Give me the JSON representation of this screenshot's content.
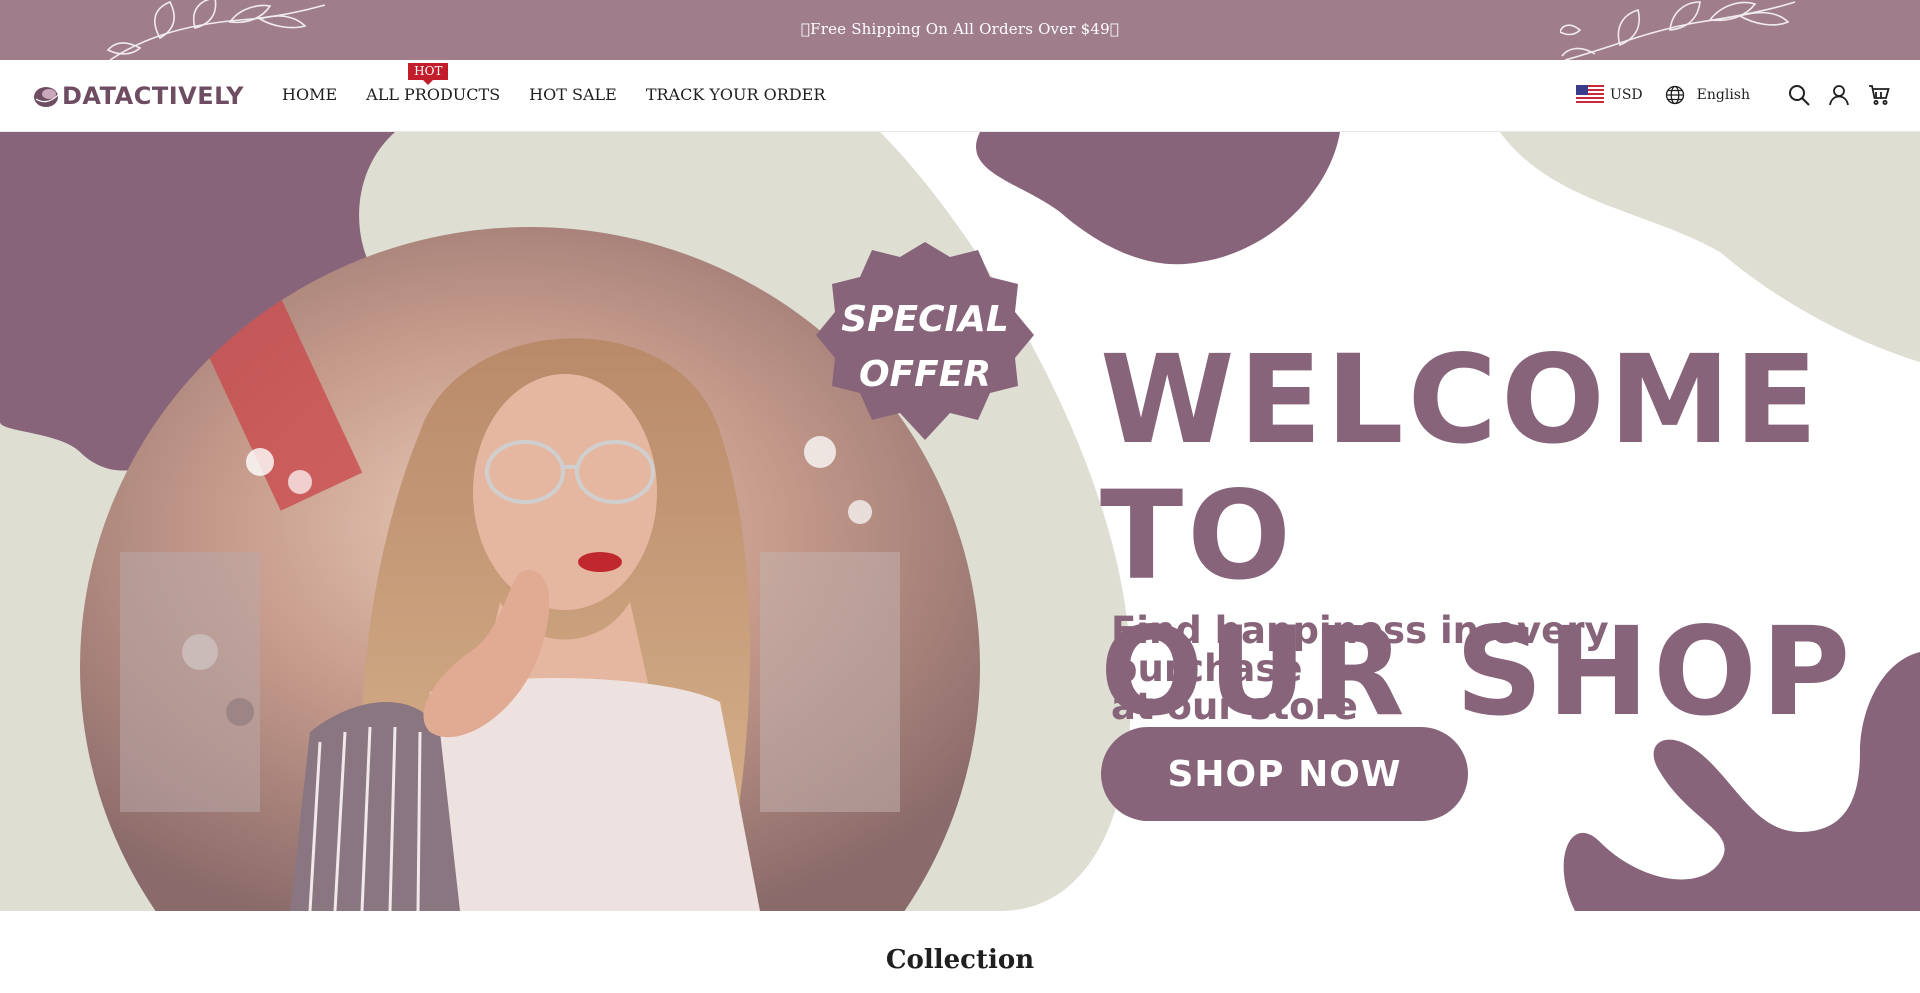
{
  "announcement": {
    "text": "\u0000Free Shipping On All Orders Over $49\u0000"
  },
  "header": {
    "logo": "DATACTIVELY",
    "nav": [
      {
        "label": "HOME"
      },
      {
        "label": "ALL PRODUCTS",
        "badge": "HOT"
      },
      {
        "label": "HOT SALE"
      },
      {
        "label": "TRACK YOUR ORDER"
      }
    ],
    "currency": "USD",
    "language": "English",
    "icons": [
      "us-flag-icon",
      "globe-icon",
      "search-icon",
      "account-icon",
      "cart-icon"
    ]
  },
  "hero": {
    "badge_line1": "SPECIAL",
    "badge_line2": "OFFER",
    "headline_line1": "WELCOME TO",
    "headline_line2": "OUR SHOP",
    "tagline_line1": "Find happiness in every purchase",
    "tagline_line2": "at our store",
    "cta": "SHOP NOW"
  },
  "collection": {
    "title": "Collection"
  },
  "colors": {
    "accent": "#87647a",
    "announcement_bg": "#a07d8b",
    "blob_beige": "#deded2",
    "hot_badge": "#c21d2b",
    "logo": "#6e4d63"
  }
}
